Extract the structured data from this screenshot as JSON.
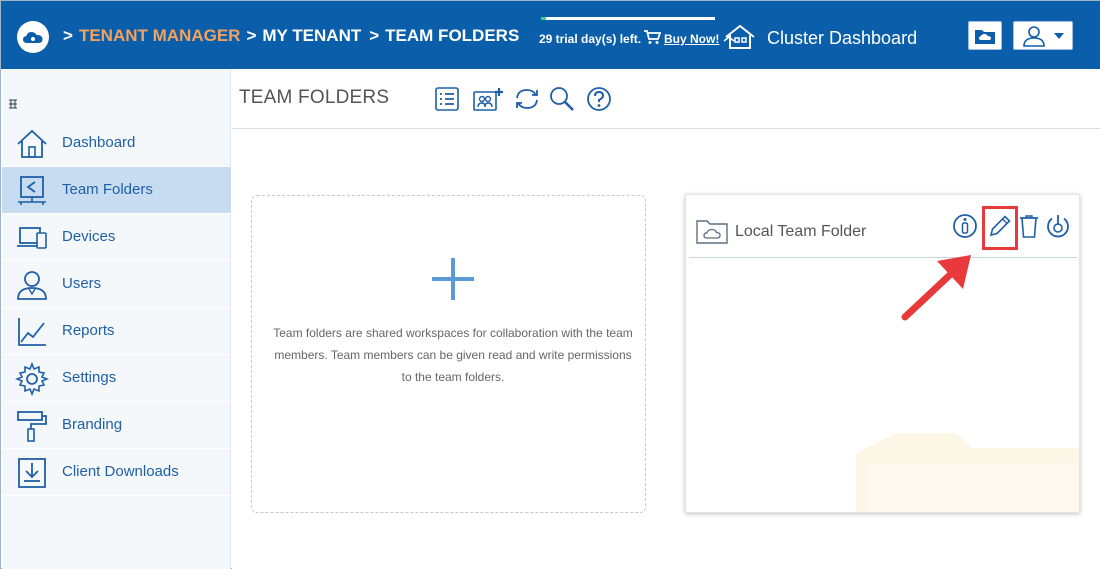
{
  "topbar": {
    "breadcrumb": {
      "sep1": ">",
      "tenant_manager": "TENANT MANAGER",
      "sep2": ">",
      "my_tenant": "MY TENANT",
      "sep3": ">",
      "team_folders": "TEAM FOLDERS"
    },
    "trial_text": "29 trial day(s) left.",
    "trial_progress": 0.03,
    "buy_now": "Buy Now!",
    "cluster_dashboard": "Cluster Dashboard"
  },
  "sidebar": {
    "items": [
      {
        "label": "Dashboard",
        "icon": "home-icon"
      },
      {
        "label": "Team Folders",
        "icon": "team-folders-icon",
        "active": true
      },
      {
        "label": "Devices",
        "icon": "devices-icon"
      },
      {
        "label": "Users",
        "icon": "users-icon"
      },
      {
        "label": "Reports",
        "icon": "reports-icon"
      },
      {
        "label": "Settings",
        "icon": "gear-icon"
      },
      {
        "label": "Branding",
        "icon": "paint-roller-icon"
      },
      {
        "label": "Client Downloads",
        "icon": "download-icon"
      }
    ]
  },
  "main": {
    "title": "TEAM FOLDERS",
    "add_card": {
      "description": "Team folders are shared workspaces for collaboration with the team members. Team members can be given read and write permissions to the team folders."
    },
    "folder_card": {
      "name": "Local Team Folder"
    }
  },
  "colors": {
    "topbar": "#0b5eaa",
    "accent": "#1f5fa6",
    "breadcrumb_highlight": "#f5a25d",
    "active_nav": "#c7dcf0",
    "annotation": "#e83a3a"
  }
}
